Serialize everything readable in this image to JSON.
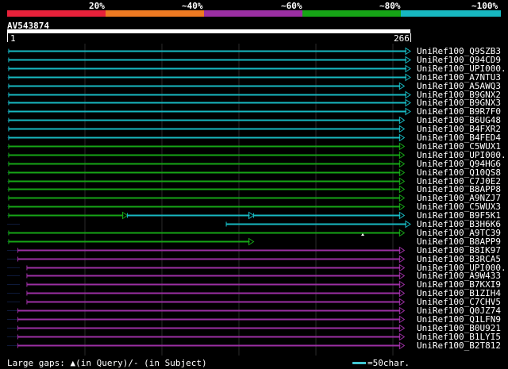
{
  "legend": {
    "percent_labels": [
      "20%",
      "~40%",
      "~60%",
      "~80%",
      "~100%"
    ],
    "colors": [
      "#e8213a",
      "#ee7a22",
      "#9b2fa3",
      "#16a516",
      "#17b8c1"
    ]
  },
  "query": {
    "id": "AV543874",
    "start": "1",
    "end": "266"
  },
  "hits": [
    {
      "label": "UniRef100_Q9SZB3",
      "color": "#17b8c1",
      "segments": [
        [
          2,
          266
        ]
      ]
    },
    {
      "label": "UniRef100_Q94CD9",
      "color": "#17b8c1",
      "segments": [
        [
          2,
          266
        ]
      ]
    },
    {
      "label": "UniRef100_UPI000..",
      "color": "#17b8c1",
      "segments": [
        [
          2,
          266
        ]
      ]
    },
    {
      "label": "UniRef100_A7NTU3",
      "color": "#17b8c1",
      "segments": [
        [
          2,
          266
        ]
      ]
    },
    {
      "label": "UniRef100_A5AWQ3",
      "color": "#17b8c1",
      "segments": [
        [
          2,
          262
        ]
      ]
    },
    {
      "label": "UniRef100_B9GNX2",
      "color": "#17b8c1",
      "segments": [
        [
          2,
          266
        ]
      ]
    },
    {
      "label": "UniRef100_B9GNX3",
      "color": "#17b8c1",
      "segments": [
        [
          2,
          266
        ]
      ]
    },
    {
      "label": "UniRef100_B9R7F0",
      "color": "#17b8c1",
      "segments": [
        [
          2,
          266
        ]
      ]
    },
    {
      "label": "UniRef100_B6UG48",
      "color": "#17b8c1",
      "segments": [
        [
          2,
          262
        ]
      ]
    },
    {
      "label": "UniRef100_B4FXR2",
      "color": "#17b8c1",
      "segments": [
        [
          2,
          262
        ]
      ]
    },
    {
      "label": "UniRef100_B4FED4",
      "color": "#17b8c1",
      "segments": [
        [
          2,
          262
        ]
      ]
    },
    {
      "label": "UniRef100_C5WUX1",
      "color": "#16a516",
      "segments": [
        [
          2,
          262
        ]
      ]
    },
    {
      "label": "UniRef100_UPI000..",
      "color": "#16a516",
      "segments": [
        [
          2,
          262
        ]
      ]
    },
    {
      "label": "UniRef100_Q94HG6",
      "color": "#16a516",
      "segments": [
        [
          2,
          262
        ]
      ]
    },
    {
      "label": "UniRef100_Q10QS8",
      "color": "#16a516",
      "segments": [
        [
          2,
          262
        ]
      ]
    },
    {
      "label": "UniRef100_C7J0E2",
      "color": "#16a516",
      "segments": [
        [
          2,
          262
        ]
      ]
    },
    {
      "label": "UniRef100_B8APP8",
      "color": "#16a516",
      "segments": [
        [
          2,
          262
        ]
      ]
    },
    {
      "label": "UniRef100_A9NZJ7",
      "color": "#16a516",
      "segments": [
        [
          2,
          262
        ]
      ]
    },
    {
      "label": "UniRef100_C5WUX3",
      "color": "#16a516",
      "segments": [
        [
          2,
          262
        ]
      ]
    },
    {
      "label": "UniRef100_B9F5K1",
      "segments": [
        [
          2,
          80,
          "#16a516"
        ],
        [
          80,
          163,
          "#17b8c1"
        ],
        [
          163,
          262,
          "#17b8c1"
        ]
      ]
    },
    {
      "label": "UniRef100_B3H6K6",
      "color": "#17b8c1",
      "segments": [
        [
          145,
          266
        ]
      ]
    },
    {
      "label": "UniRef100_A9TC39",
      "color": "#16a516",
      "segments": [
        [
          2,
          262
        ]
      ]
    },
    {
      "label": "UniRef100_B8APP9",
      "color": "#16a516",
      "segments": [
        [
          2,
          163
        ]
      ]
    },
    {
      "label": "UniRef100_B8IK97",
      "color": "#9b2fa3",
      "segments": [
        [
          8,
          262
        ]
      ]
    },
    {
      "label": "UniRef100_B3RCA5",
      "color": "#9b2fa3",
      "segments": [
        [
          8,
          262
        ]
      ]
    },
    {
      "label": "UniRef100_UPI000..",
      "color": "#9b2fa3",
      "segments": [
        [
          14,
          262
        ]
      ]
    },
    {
      "label": "UniRef100_A9W433",
      "color": "#9b2fa3",
      "segments": [
        [
          14,
          262
        ]
      ]
    },
    {
      "label": "UniRef100_B7KXI9",
      "color": "#9b2fa3",
      "segments": [
        [
          14,
          262
        ]
      ]
    },
    {
      "label": "UniRef100_B1ZIH4",
      "color": "#9b2fa3",
      "segments": [
        [
          14,
          262
        ]
      ]
    },
    {
      "label": "UniRef100_C7CHV5",
      "color": "#9b2fa3",
      "segments": [
        [
          14,
          262
        ]
      ]
    },
    {
      "label": "UniRef100_Q0JZ74",
      "color": "#9b2fa3",
      "segments": [
        [
          8,
          262
        ]
      ]
    },
    {
      "label": "UniRef100_Q1LFN9",
      "color": "#9b2fa3",
      "segments": [
        [
          8,
          262
        ]
      ]
    },
    {
      "label": "UniRef100_B0U921",
      "color": "#9b2fa3",
      "segments": [
        [
          8,
          262
        ]
      ]
    },
    {
      "label": "UniRef100_B1LYI5",
      "color": "#9b2fa3",
      "segments": [
        [
          8,
          262
        ]
      ]
    },
    {
      "label": "UniRef100_B2T812",
      "color": "#9b2fa3",
      "segments": [
        [
          8,
          262
        ]
      ]
    }
  ],
  "footer": {
    "gaps_text": "Large gaps: ▲(in Query)/- (in Subject)",
    "scale_text": "=50char.",
    "scale_color": "#40c4d0"
  }
}
